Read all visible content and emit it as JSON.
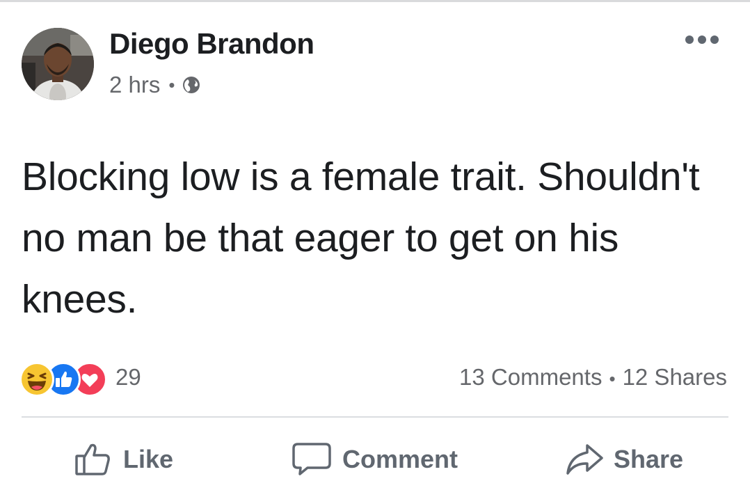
{
  "post": {
    "author": "Diego Brandon",
    "time": "2 hrs",
    "meta_separator": "•",
    "privacy_icon": "globe-icon",
    "more_icon": "more-horizontal-icon",
    "text": "Blocking low is a female trait. Shouldn't no man be that eager to get on his knees."
  },
  "reactions": {
    "icons": [
      "haha-reaction-icon",
      "like-reaction-icon",
      "love-reaction-icon"
    ],
    "count": "29"
  },
  "stats": {
    "comments": "13 Comments",
    "separator": "•",
    "shares": "12 Shares"
  },
  "actions": {
    "like_label": "Like",
    "comment_label": "Comment",
    "share_label": "Share"
  },
  "colors": {
    "text_primary": "#1c1e21",
    "text_secondary": "#65676b",
    "like_blue": "#1877f2",
    "love_red": "#f33e58",
    "haha_yellow": "#f7c531"
  }
}
